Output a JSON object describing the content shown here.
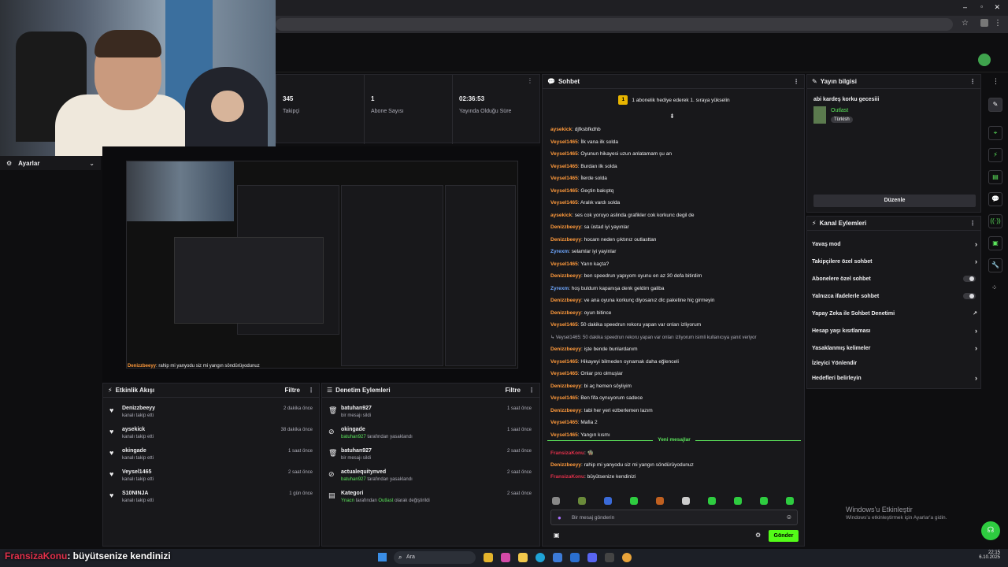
{
  "stats": [
    {
      "value": "345",
      "label": "Takipçi"
    },
    {
      "value": "1",
      "label": "Abone Sayısı"
    },
    {
      "value": "02:36:53",
      "label": "Yayında Olduğu Süre"
    }
  ],
  "settings_label": "Ayarlar",
  "preview_caption": {
    "user": "Denizzbeeyy",
    "text": ": rahip mi yanyodu siz mi yangın söndürüyodunuz"
  },
  "chat": {
    "title": "Sohbet",
    "banner_badge": "1",
    "banner": "1 abonelik hediye ederek 1. sıraya yükselin",
    "messages": [
      {
        "user": "aysekick",
        "color": "#ff9a3c",
        "text": ": djfksbfkdhb"
      },
      {
        "user": "Veysel1465",
        "color": "#ff9a3c",
        "text": ": İlk vana ilk solda"
      },
      {
        "user": "Veysel1465",
        "color": "#ff9a3c",
        "text": ": Oyunun hikayesi uzun anlatamam şu an"
      },
      {
        "user": "Veysel1465",
        "color": "#ff9a3c",
        "text": ": Burdan ilk solda"
      },
      {
        "user": "Veysel1465",
        "color": "#ff9a3c",
        "text": ": İlerde solda"
      },
      {
        "user": "Veysel1465",
        "color": "#ff9a3c",
        "text": ": Geçtin bakıptq"
      },
      {
        "user": "Veysel1465",
        "color": "#ff9a3c",
        "text": ": Aralık vardı solda"
      },
      {
        "user": "aysekick",
        "color": "#ff9a3c",
        "text": ": ses cok yoruyo aslinda grafikler cok korkunc degil de"
      },
      {
        "user": "Denizzbeeyy",
        "color": "#ff9a3c",
        "text": ": sa üstad iyi yayınlar"
      },
      {
        "user": "Denizzbeeyy",
        "color": "#ff9a3c",
        "text": ": hocam neden çıktınız outlasttan"
      },
      {
        "user": "Zyrexm",
        "color": "#6fa8ff",
        "text": ": selamlar iyi yayinlar"
      },
      {
        "user": "Veysel1465",
        "color": "#ff9a3c",
        "text": ": Yarın kaçta?"
      },
      {
        "user": "Denizzbeeyy",
        "color": "#ff9a3c",
        "text": ": ben speedrun yapıyom oyunu en az 30 defa bitirdim"
      },
      {
        "user": "Zyrexm",
        "color": "#6fa8ff",
        "text": ": hoş buldum kapanışa denk geldim galiba"
      },
      {
        "user": "Denizzbeeyy",
        "color": "#ff9a3c",
        "text": ": ve ana oyuna korkunç diyosanız dlc paketine hiç girmeyin"
      },
      {
        "user": "Denizzbeeyy",
        "color": "#ff9a3c",
        "text": ": oyun bitince"
      },
      {
        "user": "Veysel1465",
        "color": "#ff9a3c",
        "text": ": 50 dakika speedrun rekoru yapan var onları izliyorum"
      },
      {
        "user": "",
        "color": "#adadb8",
        "text": "↳ Veysel1465: 50 dakika speedrun rekoru yapan var onları izliyorum isimli kullanıcıya yanıt veriyor"
      },
      {
        "user": "Denizzbeeyy",
        "color": "#ff9a3c",
        "text": ": işte bende bunlardanım"
      },
      {
        "user": "Veysel1465",
        "color": "#ff9a3c",
        "text": ": Hikayeyi bilmeden oynamak daha eğlenceli"
      },
      {
        "user": "Veysel1465",
        "color": "#ff9a3c",
        "text": ": Onlar pro olmuşlar"
      },
      {
        "user": "Denizzbeeyy",
        "color": "#ff9a3c",
        "text": ": bi aç hemen söyliyim"
      },
      {
        "user": "Veysel1465",
        "color": "#ff9a3c",
        "text": ": Ben fifa oynuyorum sadece"
      },
      {
        "user": "Denizzbeeyy",
        "color": "#ff9a3c",
        "text": ": tabi her yeri ezberlemen lazım"
      },
      {
        "user": "Veysel1465",
        "color": "#ff9a3c",
        "text": ": Mafia 2"
      },
      {
        "user": "Veysel1465",
        "color": "#ff9a3c",
        "text": ": Yangın kısmı"
      }
    ],
    "new_messages_label": "Yeni mesajlar",
    "new_messages": [
      {
        "user": "FransizaKonu",
        "color": "#e0304a",
        "text": ": 🧌"
      },
      {
        "user": "Denizzbeeyy",
        "color": "#ff9a3c",
        "text": ": rahip mi yanyodu siz mi yangın söndürüyodunuz"
      },
      {
        "user": "FransizaKonu",
        "color": "#e0304a",
        "text": ": büyütsenize kendinizi"
      }
    ],
    "input_placeholder": "Bir mesaj gönderin",
    "send_label": "Gönder"
  },
  "stream_info": {
    "title": "Yayın bilgisi",
    "stream_title": "abi kardeş korku gecesiii",
    "game": "Outlast",
    "tag": "Türkish",
    "edit_label": "Düzenle"
  },
  "channel_actions": {
    "title": "Kanal Eylemleri",
    "items": [
      {
        "label": "Yavaş mod",
        "control": "chevron"
      },
      {
        "label": "Takipçilere özel sohbet",
        "control": "chevron"
      },
      {
        "label": "Abonelere özel sohbet",
        "control": "toggle"
      },
      {
        "label": "Yalnızca ifadelerle sohbet",
        "control": "toggle"
      },
      {
        "label": "Yapay Zeka ile Sohbet Denetimi",
        "control": "external"
      },
      {
        "label": "Hesap yaşı kısıtlaması",
        "control": "chevron"
      },
      {
        "label": "Yasaklanmış kelimeler",
        "control": "chevron"
      },
      {
        "label": "İzleyici Yönlendir",
        "control": "none"
      },
      {
        "label": "Hedefleri belirleyin",
        "control": "chevron"
      }
    ]
  },
  "activity": {
    "title": "Etkinlik Akışı",
    "filter_label": "Filtre",
    "items": [
      {
        "name": "Denizzbeeyy",
        "sub": "kanalı takip etti",
        "time": "2 dakika önce"
      },
      {
        "name": "aysekick",
        "sub": "kanalı takip etti",
        "time": "38 dakika önce"
      },
      {
        "name": "okingade",
        "sub": "kanalı takip etti",
        "time": "1 saat önce"
      },
      {
        "name": "Veysel1465",
        "sub": "kanalı takip etti",
        "time": "2 saat önce"
      },
      {
        "name": "S10NINJA",
        "sub": "kanalı takip etti",
        "time": "1 gün önce"
      }
    ]
  },
  "moderation": {
    "title": "Denetim Eylemleri",
    "filter_label": "Filtre",
    "items": [
      {
        "name": "batuhan927",
        "sub": "bir mesajı sildi",
        "sub_user": "",
        "time": "1 saat önce",
        "icon": "trash-icon"
      },
      {
        "name": "okingade",
        "sub": "tarafından yasaklandı",
        "sub_user": "batuhan927",
        "time": "1 saat önce",
        "icon": "ban-icon"
      },
      {
        "name": "batuhan927",
        "sub": "bir mesajı sildi",
        "sub_user": "",
        "time": "2 saat önce",
        "icon": "trash-icon"
      },
      {
        "name": "actualequitynved",
        "sub": "tarafından yasaklandı",
        "sub_user": "batuhan927",
        "time": "2 saat önce",
        "icon": "ban-icon"
      },
      {
        "name": "Kategori",
        "sub": "tarafından",
        "sub_user": "Ynacn",
        "sub_game": "Outlast",
        "sub_tail": "olarak değiştirildi",
        "time": "2 saat önce",
        "icon": "category-icon"
      }
    ]
  },
  "watermark": {
    "line1": "Windows'u Etkinleştir",
    "line2": "Windows'u etkinleştirmek için Ayarlar'a gidin."
  },
  "overlay_caption": {
    "user": "FransizaKonu",
    "text": ": büyütsenize kendinizi"
  },
  "taskbar": {
    "search": "Ara",
    "time": "22:15",
    "date": "6.10.2025"
  }
}
